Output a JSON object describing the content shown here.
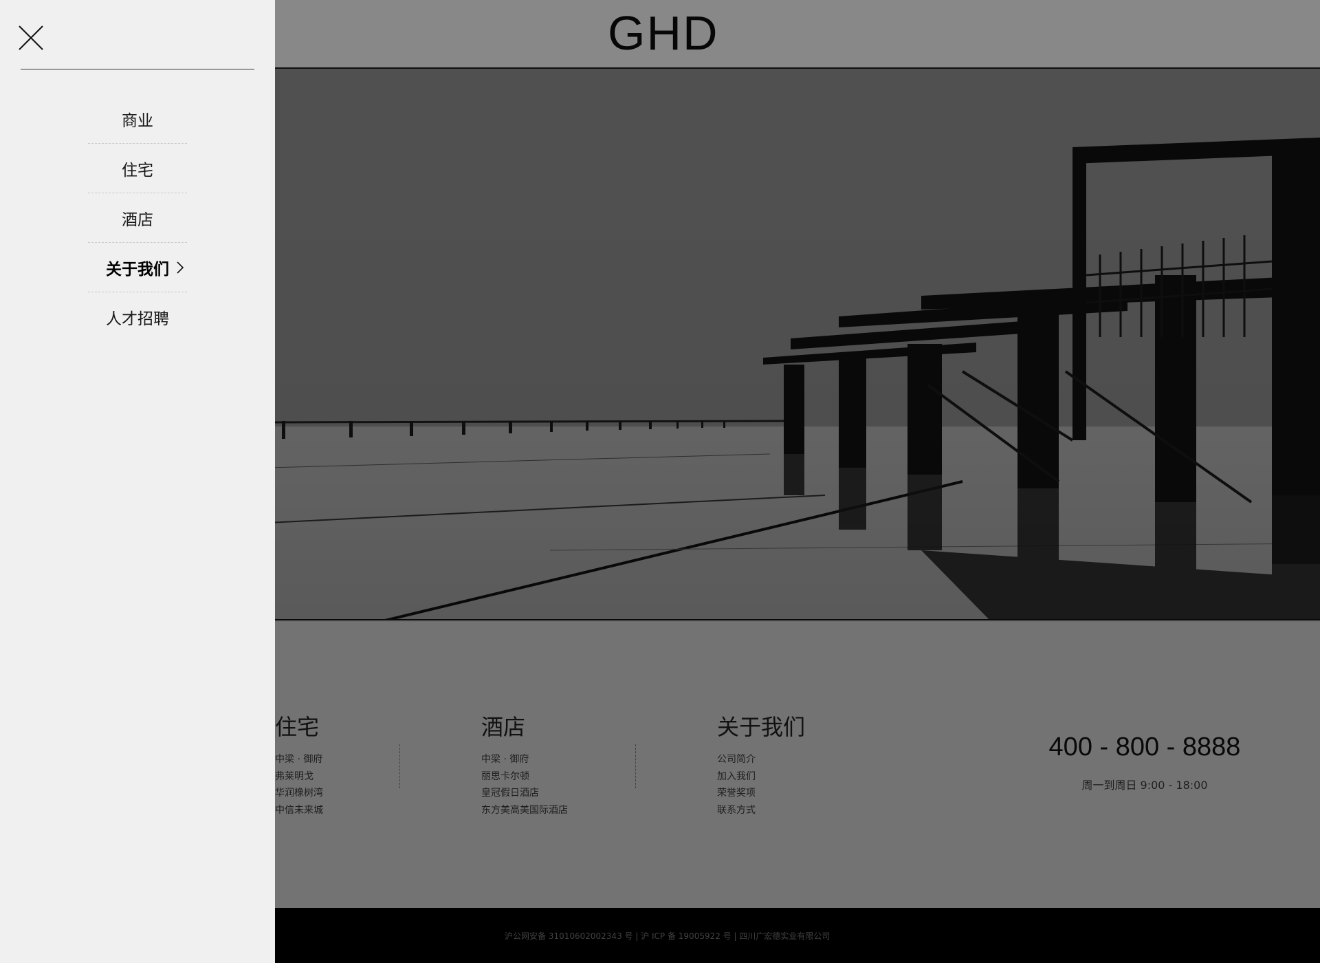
{
  "header": {
    "logo": "GHD"
  },
  "drawer": {
    "menu": [
      {
        "label": "商业",
        "active": false
      },
      {
        "label": "住宅",
        "active": false
      },
      {
        "label": "酒店",
        "active": false
      },
      {
        "label": "关于我们",
        "active": true
      },
      {
        "label": "人才招聘",
        "active": false
      }
    ]
  },
  "footer": {
    "columns": [
      {
        "title": "住宅",
        "links": [
          "中梁 · 御府",
          "弗莱明戈",
          "华润橡树湾",
          "中信未来城"
        ]
      },
      {
        "title": "酒店",
        "links": [
          "中梁 · 御府",
          "丽思卡尔顿",
          "皇冠假日酒店",
          "东方美高美国际酒店"
        ]
      },
      {
        "title": "关于我们",
        "links": [
          "公司简介",
          "加入我们",
          "荣誉奖项",
          "联系方式"
        ]
      }
    ],
    "phone": "400 - 800 - 8888",
    "hours": "周一到周日 9:00 - 18:00",
    "copyright": "沪公网安备 31010602002343 号  |  沪 ICP 备 19005922 号  |  四川广宏德实业有限公司"
  },
  "icons": {
    "close": "close-icon",
    "chevron": "chevron-right-icon"
  }
}
